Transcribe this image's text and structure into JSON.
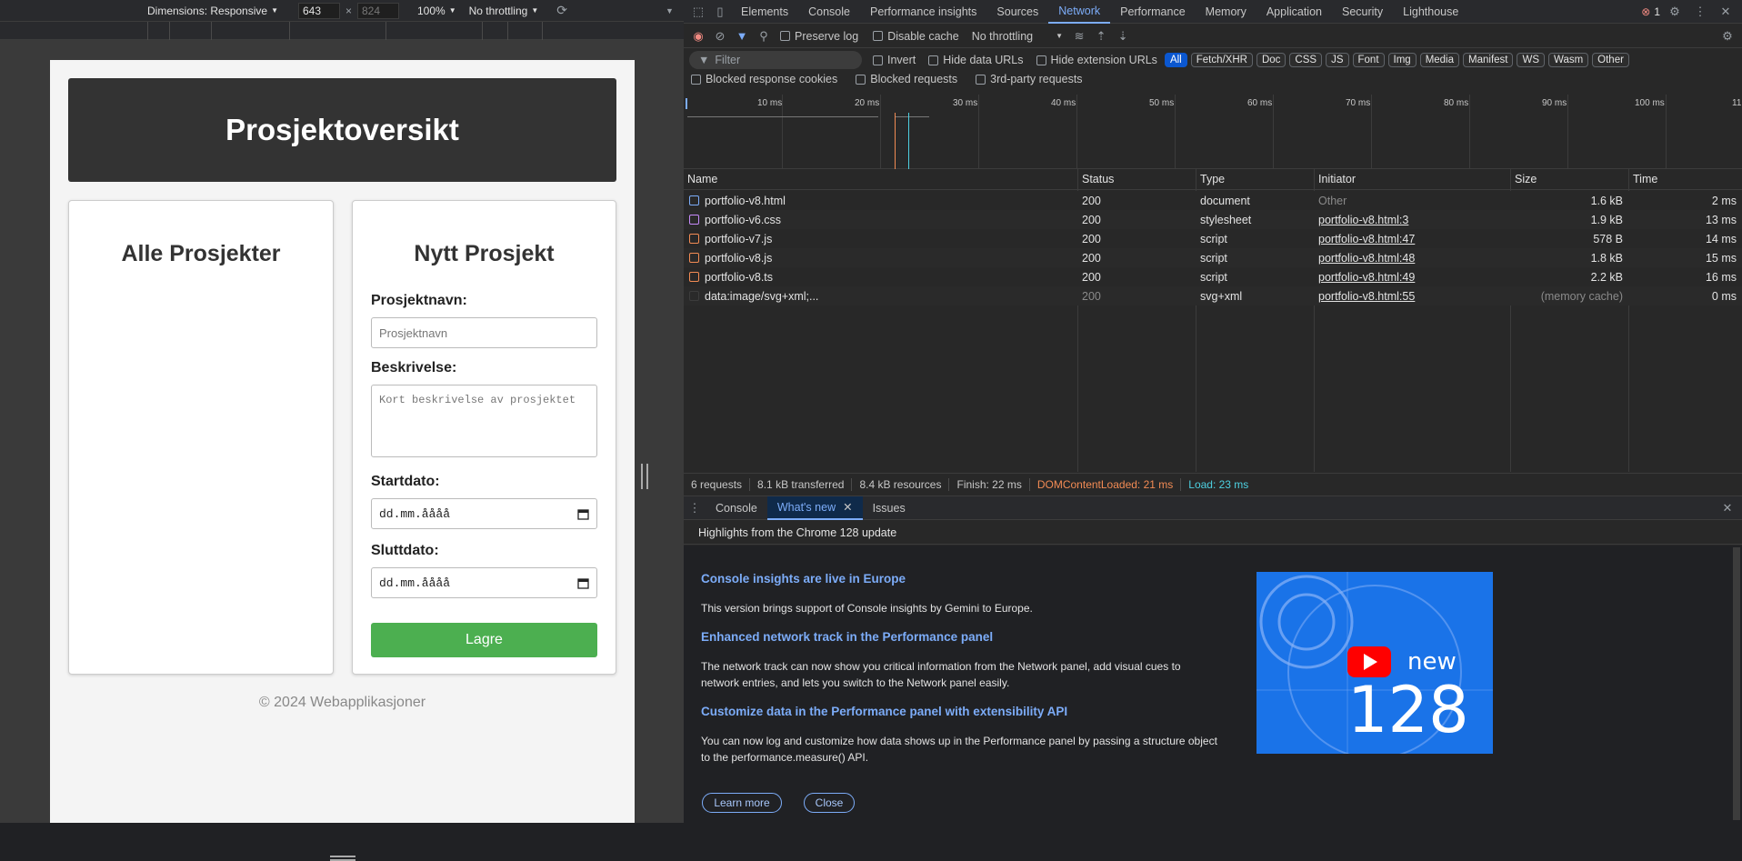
{
  "device_toolbar": {
    "dimensions": "Dimensions: Responsive",
    "width": "643",
    "times": "×",
    "height": "824",
    "zoom": "100%",
    "throttle": "No throttling"
  },
  "page": {
    "header": "Prosjektoversikt",
    "left_card_title": "Alle Prosjekter",
    "right_card_title": "Nytt Prosjekt",
    "label_name": "Prosjektnavn:",
    "placeholder_name": "Prosjektnavn",
    "label_desc": "Beskrivelse:",
    "placeholder_desc": "Kort beskrivelse av prosjektet",
    "label_start": "Startdato:",
    "date_start": "dd.mm.åååå",
    "label_end": "Sluttdato:",
    "date_end": "dd.mm.åååå",
    "save_button": "Lagre",
    "footer": "© 2024 Webapplikasjoner"
  },
  "devtools": {
    "tabs": [
      "Elements",
      "Console",
      "Performance insights",
      "Sources",
      "Network",
      "Performance",
      "Memory",
      "Application",
      "Security",
      "Lighthouse"
    ],
    "active_tab": "Network",
    "error_count": "1",
    "toolbar": {
      "preserve_log": "Preserve log",
      "disable_cache": "Disable cache",
      "throttling": "No throttling"
    },
    "filter": {
      "placeholder": "Filter",
      "invert": "Invert",
      "hide_data_urls": "Hide data URLs",
      "hide_extension_urls": "Hide extension URLs",
      "chips": [
        "All",
        "Fetch/XHR",
        "Doc",
        "CSS",
        "JS",
        "Font",
        "Img",
        "Media",
        "Manifest",
        "WS",
        "Wasm",
        "Other"
      ],
      "blocked_cookies": "Blocked response cookies",
      "blocked_requests": "Blocked requests",
      "third_party": "3rd-party requests"
    },
    "timeline_labels": [
      "10 ms",
      "20 ms",
      "30 ms",
      "40 ms",
      "50 ms",
      "60 ms",
      "70 ms",
      "80 ms",
      "90 ms",
      "100 ms",
      "11"
    ],
    "columns": [
      "Name",
      "Status",
      "Type",
      "Initiator",
      "Size",
      "Time"
    ],
    "rows": [
      {
        "name": "portfolio-v8.html",
        "status": "200",
        "type": "document",
        "initiator": "Other",
        "size": "1.6 kB",
        "time": "2 ms",
        "icon_color": "#7cacf8"
      },
      {
        "name": "portfolio-v6.css",
        "status": "200",
        "type": "stylesheet",
        "initiator": "portfolio-v8.html:3",
        "size": "1.9 kB",
        "time": "13 ms",
        "icon_color": "#c58af9"
      },
      {
        "name": "portfolio-v7.js",
        "status": "200",
        "type": "script",
        "initiator": "portfolio-v8.html:47",
        "size": "578 B",
        "time": "14 ms",
        "icon_color": "#f28b54"
      },
      {
        "name": "portfolio-v8.js",
        "status": "200",
        "type": "script",
        "initiator": "portfolio-v8.html:48",
        "size": "1.8 kB",
        "time": "15 ms",
        "icon_color": "#f28b54"
      },
      {
        "name": "portfolio-v8.ts",
        "status": "200",
        "type": "script",
        "initiator": "portfolio-v8.html:49",
        "size": "2.2 kB",
        "time": "16 ms",
        "icon_color": "#f28b54"
      },
      {
        "name": "data:image/svg+xml;...",
        "status": "200",
        "type": "svg+xml",
        "initiator": "portfolio-v8.html:55",
        "size": "(memory cache)",
        "time": "0 ms",
        "icon_color": "#3c3c3c"
      }
    ],
    "summary": {
      "requests": "6 requests",
      "transferred": "8.1 kB transferred",
      "resources": "8.4 kB resources",
      "finish": "Finish: 22 ms",
      "dcl": "DOMContentLoaded: 21 ms",
      "load": "Load: 23 ms"
    },
    "drawer": {
      "tabs": [
        "Console",
        "What's new",
        "Issues"
      ],
      "heading": "Highlights from the Chrome 128 update",
      "items": [
        {
          "title": "Console insights are live in Europe",
          "text": "This version brings support of Console insights by Gemini to Europe."
        },
        {
          "title": "Enhanced network track in the Performance panel",
          "text": "The network track can now show you critical information from the Network panel, add visual cues to network entries, and lets you switch to the Network panel easily."
        },
        {
          "title": "Customize data in the Performance panel with extensibility API",
          "text": "You can now log and customize how data shows up in the Performance panel by passing a structure object to the performance.measure() API."
        }
      ],
      "learn_more": "Learn more",
      "close": "Close",
      "promo_new": "new",
      "promo_version": "128"
    }
  }
}
